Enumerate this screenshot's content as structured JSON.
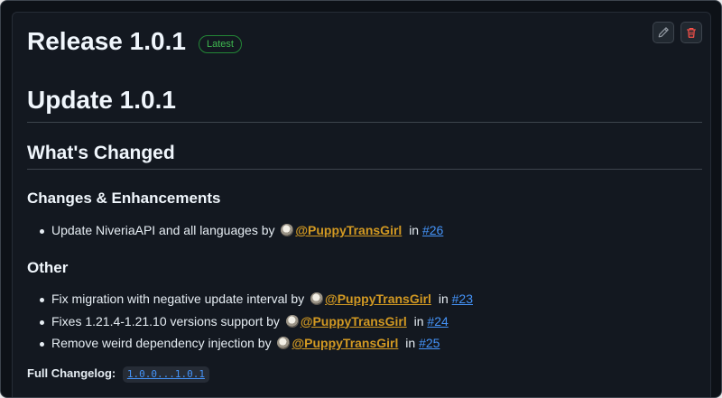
{
  "release": {
    "title": "Release 1.0.1",
    "badge": "Latest",
    "actions": {
      "edit_icon": "pencil-icon",
      "delete_icon": "trash-icon"
    }
  },
  "notes": {
    "heading": "Update 1.0.1",
    "whats_changed": "What's Changed",
    "sections": [
      {
        "title": "Changes & Enhancements",
        "items": [
          {
            "text": "Update NiveriaAPI and all languages by",
            "author": "@PuppyTransGirl",
            "in": "in",
            "pr": "#26"
          }
        ]
      },
      {
        "title": "Other",
        "items": [
          {
            "text": "Fix migration with negative update interval by",
            "author": "@PuppyTransGirl",
            "in": "in",
            "pr": "#23"
          },
          {
            "text": "Fixes 1.21.4-1.21.10 versions support by",
            "author": "@PuppyTransGirl",
            "in": "in",
            "pr": "#24"
          },
          {
            "text": "Remove weird dependency injection by",
            "author": "@PuppyTransGirl",
            "in": "in",
            "pr": "#25"
          }
        ]
      }
    ],
    "full_changelog_label": "Full Changelog:",
    "full_changelog_link": "1.0.0...1.0.1"
  },
  "colors": {
    "background": "#0d1117",
    "mention": "#d29922",
    "link": "#4493f8",
    "badge": "#3fb950",
    "delete": "#f85149"
  }
}
